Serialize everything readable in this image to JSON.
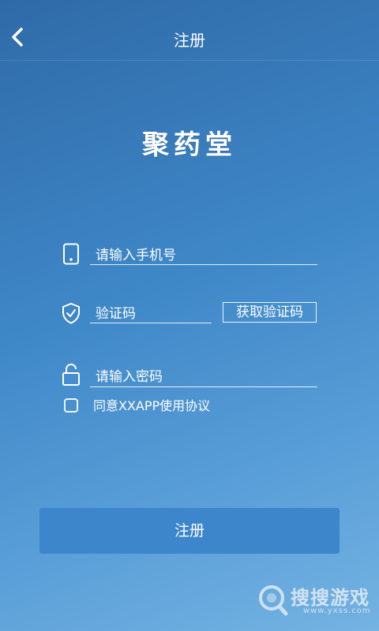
{
  "header": {
    "title": "注册"
  },
  "brand": {
    "name": "聚药堂"
  },
  "form": {
    "phone_placeholder": "请输入手机号",
    "code_placeholder": "验证码",
    "get_code_label": "获取验证码",
    "password_placeholder": "请输入密码",
    "agreement_label": "同意XXAPP使用协议",
    "agreement_checked": false
  },
  "actions": {
    "submit_label": "注册"
  },
  "watermark": {
    "name": "搜搜游戏",
    "url": "www.yxss.com"
  },
  "icons": [
    "back-arrow-icon",
    "phone-icon",
    "shield-check-icon",
    "unlock-icon",
    "magnifier-icon"
  ],
  "colors": {
    "button": "#3d86cc",
    "background_top": "#2f6aa8",
    "background_bottom": "#74b3e2"
  }
}
